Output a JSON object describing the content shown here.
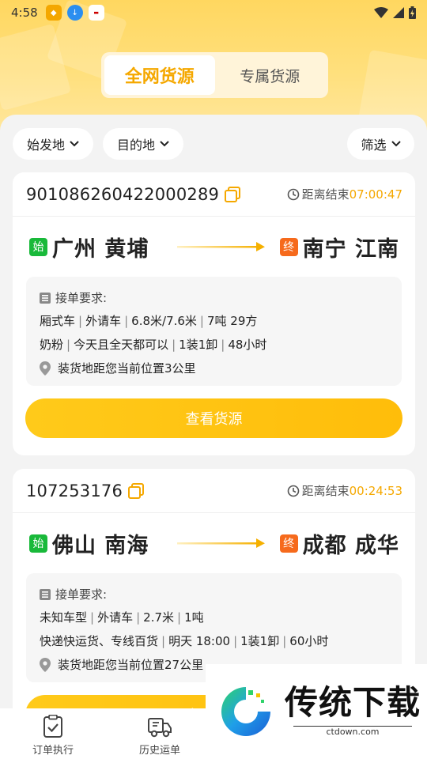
{
  "status_bar": {
    "time": "4:58"
  },
  "tabs": [
    {
      "label": "全网货源",
      "active": true
    },
    {
      "label": "专属货源",
      "active": false
    }
  ],
  "filters": {
    "origin": "始发地",
    "destination": "目的地",
    "filter": "筛选"
  },
  "labels": {
    "deadline": "距离结束",
    "start_tag": "始",
    "end_tag": "终",
    "requirements": "接单要求:",
    "view_button": "查看货源"
  },
  "orders": [
    {
      "order_no": "901086260422000289",
      "countdown": "07:00:47",
      "from": "广州 黄埔",
      "to": "南宁 江南",
      "req_line1": [
        "厢式车",
        "外请车",
        "6.8米/7.6米",
        "7吨 29方"
      ],
      "req_line2": [
        "奶粉",
        "今天且全天都可以",
        "1装1卸",
        "48小时"
      ],
      "distance": "装货地距您当前位置3公里"
    },
    {
      "order_no": "107253176",
      "countdown": "00:24:53",
      "from": "佛山 南海",
      "to": "成都 成华",
      "req_line1": [
        "未知车型",
        "外请车",
        "2.7米",
        "1吨"
      ],
      "req_line2": [
        "快递快运货、专线百货",
        "明天 18:00",
        "1装1卸",
        "60小时"
      ],
      "distance": "装货地距您当前位置27公里"
    }
  ],
  "bottom_nav": [
    {
      "label": "订单执行"
    },
    {
      "label": "历史运单"
    }
  ],
  "watermark": {
    "title": "传统下载",
    "url": "ctdown.com"
  },
  "colors": {
    "accent": "#f5a800",
    "button": "#ffc20e",
    "start_tag": "#19b93a",
    "end_tag": "#f66a1c"
  }
}
